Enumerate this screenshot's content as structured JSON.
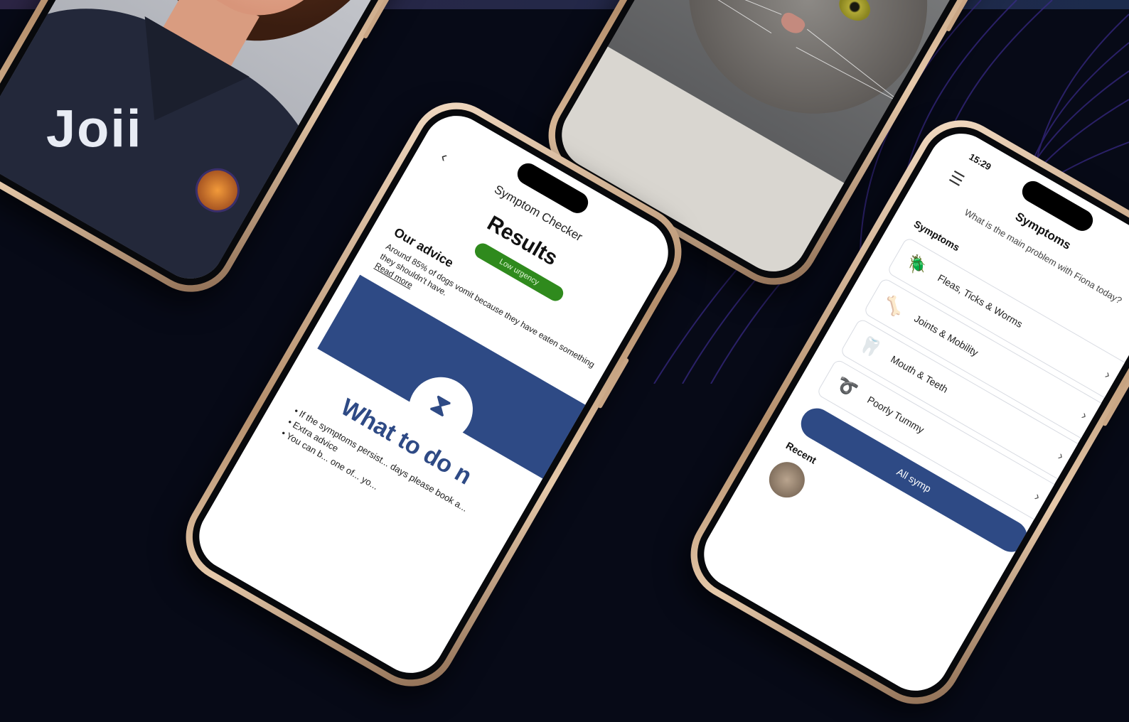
{
  "vet_phone": {
    "shirt_logo": "Joii"
  },
  "results_phone": {
    "back_icon": "chevron-left-icon",
    "header_title": "Symptom Checker",
    "title": "Results",
    "urgency_badge": "Low urgency",
    "advice_heading": "Our advice",
    "advice_text": "Around 85% of dogs vomit because they have eaten something they shouldn't have.",
    "read_more": "Read more",
    "hourglass_icon": "hourglass-icon",
    "section_title": "What to do n",
    "bullets": [
      "If the symptoms persist... days please book a...",
      "Extra advice",
      "You can b... one of... yo..."
    ]
  },
  "symptoms_phone": {
    "status_time": "15:29",
    "menu_icon": "hamburger-menu-icon",
    "title": "Symptoms",
    "question": "What is the main problem with Fiona today?",
    "list_heading": "Symptoms",
    "items": [
      {
        "label": "Fleas, Ticks & Worms",
        "icon": "🪲"
      },
      {
        "label": "Joints & Mobility",
        "icon": "🦴"
      },
      {
        "label": "Mouth & Teeth",
        "icon": "🦷"
      },
      {
        "label": "Poorly Tummy",
        "icon": "➰"
      }
    ],
    "all_button": "All symp",
    "recent_heading": "Recent"
  },
  "colors": {
    "brand_blue": "#2e4a85",
    "urgency_green": "#2f8a1d",
    "background": "#070a17"
  }
}
